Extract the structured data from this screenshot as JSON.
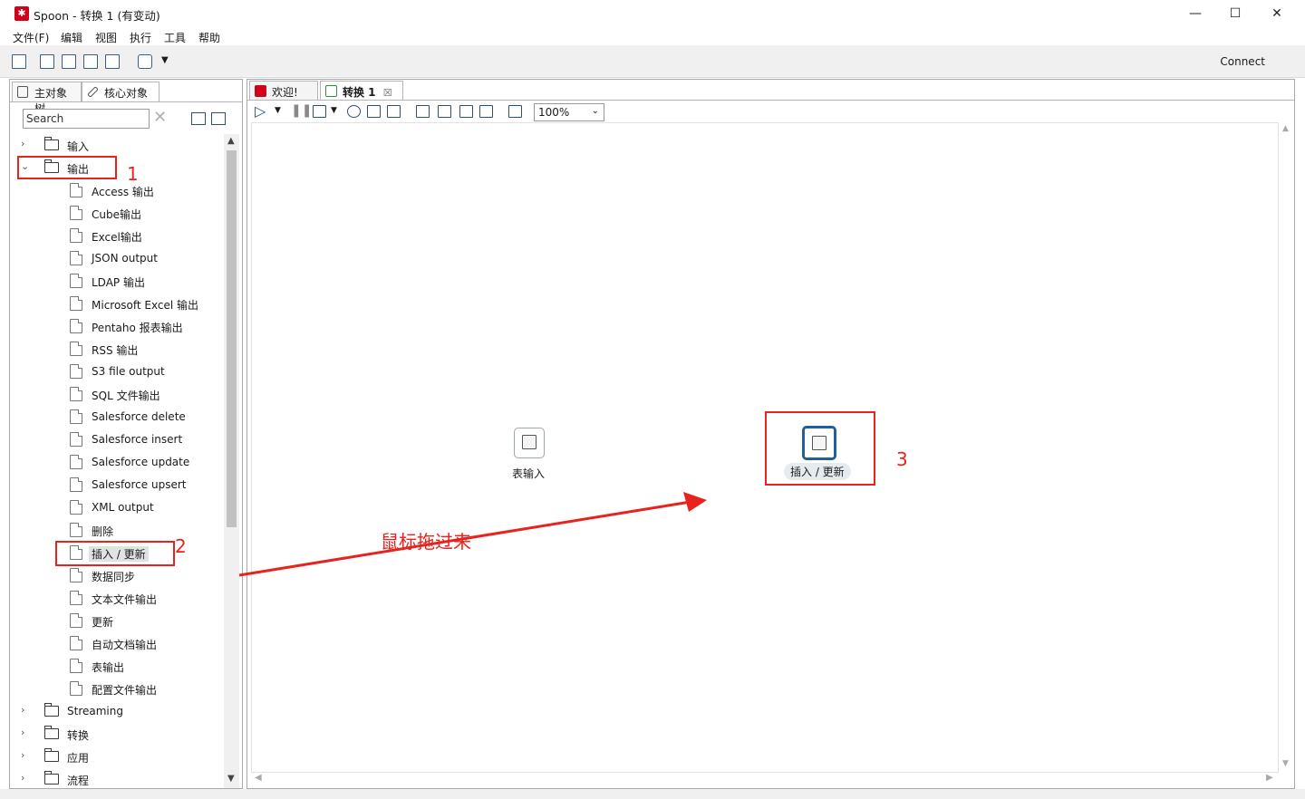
{
  "window": {
    "title": "Spoon - 转换 1 (有变动)",
    "minimize": "—",
    "maximize": "☐",
    "close": "✕"
  },
  "menu": [
    "文件(F)",
    "编辑",
    "视图",
    "执行",
    "工具",
    "帮助"
  ],
  "toolbar": {
    "connect_label": "Connect"
  },
  "left_panel": {
    "tabs": [
      "主对象树",
      "核心对象"
    ],
    "search": {
      "value": "Search"
    },
    "tree": {
      "folder_input": "输入",
      "folder_output": "输出",
      "output_steps": [
        "Access 输出",
        "Cube输出",
        "Excel输出",
        "JSON output",
        "LDAP 输出",
        "Microsoft Excel 输出",
        "Pentaho 报表输出",
        "RSS 输出",
        "S3 file output",
        "SQL 文件输出",
        "Salesforce delete",
        "Salesforce insert",
        "Salesforce update",
        "Salesforce upsert",
        "XML output",
        "删除",
        "插入 / 更新",
        "数据同步",
        "文本文件输出",
        "更新",
        "自动文档输出",
        "表输出",
        "配置文件输出"
      ],
      "folders_after": [
        "Streaming",
        "转换",
        "应用",
        "流程"
      ]
    }
  },
  "right_panel": {
    "tabs": [
      "欢迎!",
      "转换 1"
    ],
    "tab_close": "☒",
    "zoom": "100%",
    "steps": {
      "table_input": "表输入",
      "insert_update": "插入 / 更新"
    }
  },
  "annotations": {
    "n1": "1",
    "n2": "2",
    "n3": "3",
    "drag_note": "鼠标拖过来",
    "accent": "#e8231d"
  }
}
